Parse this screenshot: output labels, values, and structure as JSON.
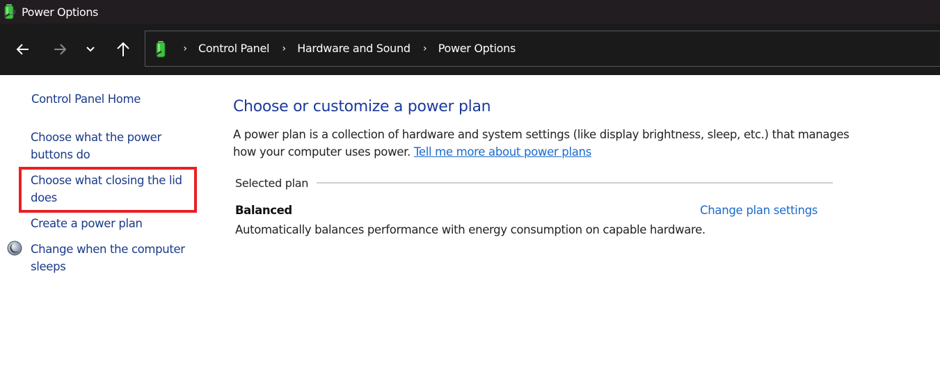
{
  "window": {
    "title": "Power Options",
    "icon": "power-options-battery-icon"
  },
  "navigation": {
    "back": {
      "icon": "arrow-left-icon",
      "enabled": true
    },
    "forward": {
      "icon": "arrow-right-icon",
      "enabled": false
    },
    "recent": {
      "icon": "chevron-down-icon"
    },
    "up": {
      "icon": "arrow-up-icon"
    }
  },
  "address_bar": {
    "icon": "power-options-battery-icon",
    "separator": "›",
    "breadcrumbs": [
      "Control Panel",
      "Hardware and Sound",
      "Power Options"
    ]
  },
  "sidebar": {
    "home_link": "Control Panel Home",
    "items": [
      {
        "label_line1": "Choose what the power",
        "label_line2": "buttons do",
        "highlighted": false
      },
      {
        "label_line1": "Choose what closing the lid",
        "label_line2": "does",
        "highlighted": true
      },
      {
        "label_line1": "Create a power plan",
        "highlighted": false
      },
      {
        "label_line1": "Change when the computer",
        "label_line2": "sleeps",
        "icon": "moon-sleep-icon",
        "highlighted": false
      }
    ],
    "highlight_color": "#e81f24"
  },
  "main": {
    "title": "Choose or customize a power plan",
    "description_line1": "A power plan is a collection of hardware and system settings (like display brightness, sleep, etc.) that manages",
    "description_line2": "how your computer uses power.",
    "learn_more_link": "Tell me more about power plans",
    "selected_plan_group_label": "Selected plan",
    "plan": {
      "name": "Balanced",
      "description": "Automatically balances performance with energy consumption on capable hardware.",
      "settings_link": "Change plan settings"
    }
  },
  "colors": {
    "title_bar": "#221d20",
    "nav_bar": "#1a1a1a",
    "link": "#1a6acb",
    "heading": "#1a3a9a",
    "sidebar_link": "#1a3a8a"
  }
}
